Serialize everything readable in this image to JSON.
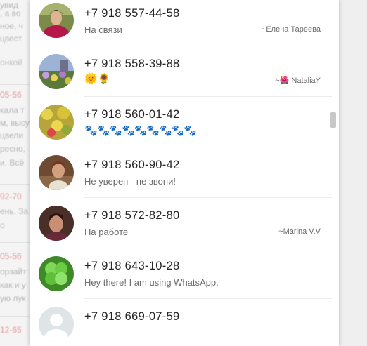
{
  "background": {
    "lines": [
      {
        "text": "увид"
      },
      {
        "text": ", а во"
      },
      {
        "text": "ное, ч"
      },
      {
        "text": "цвест"
      },
      {
        "text": "онкой"
      },
      {
        "text": "05-56"
      },
      {
        "text": "кала т"
      },
      {
        "text": "м, высу"
      },
      {
        "text": "цвели"
      },
      {
        "text": "ресно,"
      },
      {
        "text": "и. Всё"
      },
      {
        "text": "92-70"
      },
      {
        "text": "ень. За"
      },
      {
        "text": "о"
      },
      {
        "text": "05-56"
      },
      {
        "text": "орзайт"
      },
      {
        "text": "как и у"
      },
      {
        "text": "ую лук"
      },
      {
        "text": "12-65"
      }
    ]
  },
  "contacts": [
    {
      "phone": "+7 918 557-44-58",
      "status": "На связи",
      "nickname": "~Елена Тареева",
      "avatar_icon": "photo-woman-red-icon"
    },
    {
      "phone": "+7 918 558-39-88",
      "status": "🌞🌻",
      "nickname": "~🌺 NataliaY",
      "avatar_icon": "photo-flowers-icon"
    },
    {
      "phone": "+7 918 560-01-42",
      "status": "🐾🐾🐾🐾🐾🐾🐾🐾🐾",
      "nickname": "",
      "avatar_icon": "photo-yellow-flowers-icon"
    },
    {
      "phone": "+7 918 560-90-42",
      "status": "Не уверен - не звони!",
      "nickname": "",
      "avatar_icon": "photo-woman-brown-icon"
    },
    {
      "phone": "+7 918 572-82-80",
      "status": "На работе",
      "nickname": "~Marina V.V",
      "avatar_icon": "photo-woman-dark-icon"
    },
    {
      "phone": "+7 918 643-10-28",
      "status": "Hey there! I am using WhatsApp.",
      "nickname": "",
      "avatar_icon": "photo-clover-icon"
    },
    {
      "phone": "+7 918 669-07-59",
      "status": "",
      "nickname": "",
      "avatar_icon": "default-avatar-icon"
    }
  ],
  "colors": {
    "panel_bg": "#ffffff",
    "primary_text": "#262626",
    "secondary_text": "#6b6b6b",
    "separator": "#ececec"
  }
}
